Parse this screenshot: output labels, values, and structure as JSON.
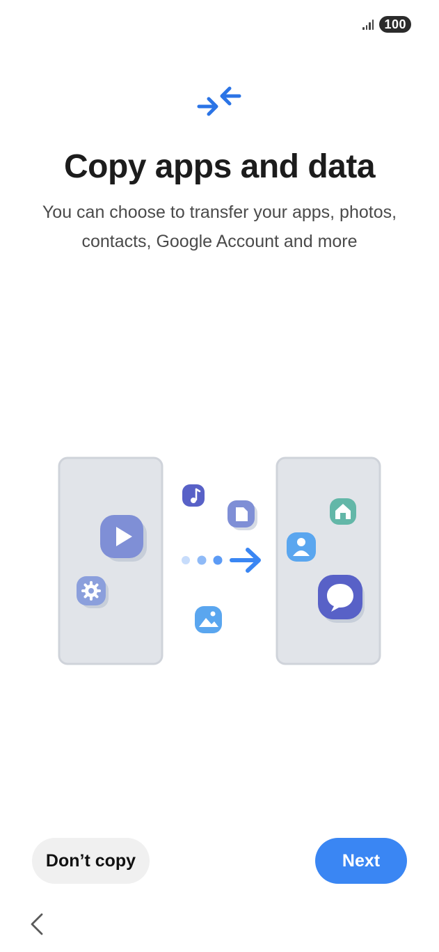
{
  "status_bar": {
    "signal_icon": "signal-strength-icon",
    "battery_level": "100"
  },
  "header": {
    "icon": "transfer-arrows-icon",
    "title": "Copy apps and data",
    "subtitle": "You can choose to transfer your apps, photos, contacts, Google Account and more"
  },
  "illustration": {
    "source_app_icons": [
      "video-play-icon",
      "settings-gear-icon"
    ],
    "transfer_icons": [
      "music-note-icon",
      "document-icon",
      "photo-icon"
    ],
    "target_app_icons": [
      "home-icon",
      "contact-icon",
      "message-bubble-icon"
    ],
    "colors": {
      "phone_fill": "#e1e4e9",
      "phone_stroke": "#cfd3da",
      "arrow_blue": "#3a86f3",
      "dot_light": "#b9d3fb",
      "dot_mid": "#7aaef6",
      "indigo": "#5861c7",
      "periwinkle": "#7f8fd6",
      "sky": "#5aa6ef",
      "teal": "#63b7a8"
    }
  },
  "actions": {
    "dont_copy_label": "Don’t copy",
    "next_label": "Next"
  },
  "navigation": {
    "back_icon": "back-chevron-icon"
  },
  "colors": {
    "primary": "#3a86f3",
    "secondary_button": "#f0f0f0",
    "title_text": "#1c1c1c",
    "subtitle_text": "#4a4a4a"
  }
}
